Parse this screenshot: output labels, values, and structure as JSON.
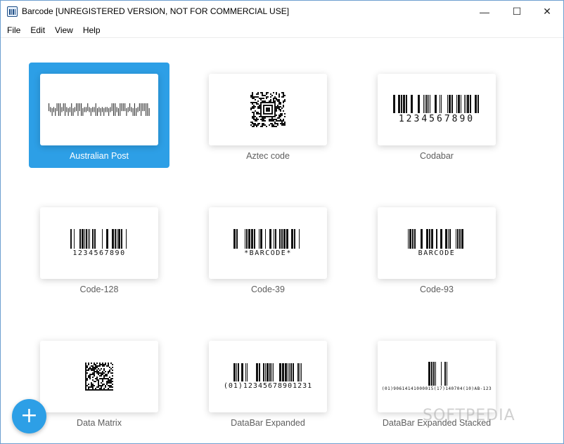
{
  "window": {
    "title": "Barcode [UNREGISTERED VERSION, NOT FOR COMMERCIAL USE]",
    "controls": {
      "minimize": "—",
      "maximize": "☐",
      "close": "✕"
    }
  },
  "menu": [
    "File",
    "Edit",
    "View",
    "Help"
  ],
  "barcodes": [
    {
      "label": "Australian Post",
      "selected": true
    },
    {
      "label": "Aztec code",
      "selected": false
    },
    {
      "label": "Codabar",
      "selected": false,
      "text": "1234567890"
    },
    {
      "label": "Code-128",
      "selected": false,
      "text": "1234567890"
    },
    {
      "label": "Code-39",
      "selected": false,
      "text": "*BARCODE*"
    },
    {
      "label": "Code-93",
      "selected": false,
      "text": "BARCODE"
    },
    {
      "label": "Data Matrix",
      "selected": false
    },
    {
      "label": "DataBar Expanded",
      "selected": false,
      "text": "(01)12345678901231"
    },
    {
      "label": "DataBar Expanded Stacked",
      "selected": false,
      "text": "(01)90614141000015(17)140704(10)AB-123"
    }
  ],
  "fab": {
    "label": "+"
  },
  "watermark": "SOFTPEDIA",
  "colors": {
    "accent": "#2d9fe6",
    "label": "#5e5e5e"
  }
}
